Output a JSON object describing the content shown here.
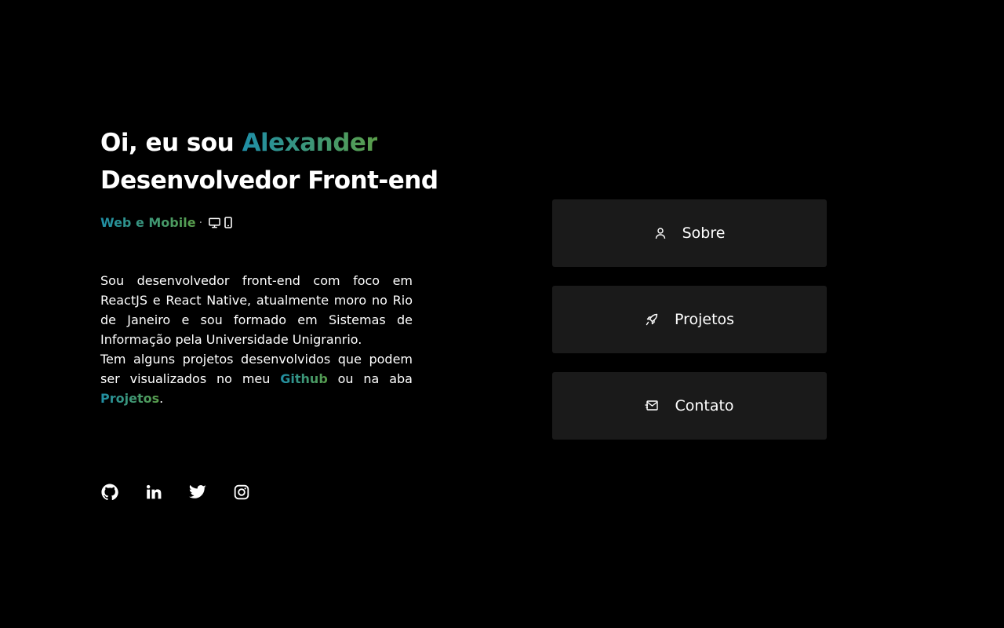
{
  "hero": {
    "greeting": "Oi, eu sou",
    "name": "Alexander",
    "role": "Desenvolvedor Front-end",
    "platforms_label": "Web e Mobile",
    "platforms_separator": "·",
    "platform_icons": [
      "desktop-icon",
      "mobile-icon"
    ]
  },
  "bio": {
    "line1": "Sou desenvolvedor front-end com foco em ReactJS e React Native, atualmente moro no Rio de Janeiro e sou formado em Sistemas de Informação pela Universidade Unigranrio.",
    "line2_start": "Tem alguns projetos desenvolvidos que podem ser visualizados no meu",
    "github_link": "Github",
    "line2_middle": "ou na aba",
    "projects_link": "Projetos",
    "line2_end": "."
  },
  "social": [
    "github-icon",
    "linkedin-icon",
    "twitter-icon",
    "instagram-icon"
  ],
  "menu": {
    "about": "Sobre",
    "projects": "Projetos",
    "contact": "Contato"
  },
  "colors": {
    "background": "#000000",
    "button_bg": "#1a1a1a",
    "gradient_start": "#1f8ea6",
    "gradient_end": "#5a9e4a"
  }
}
